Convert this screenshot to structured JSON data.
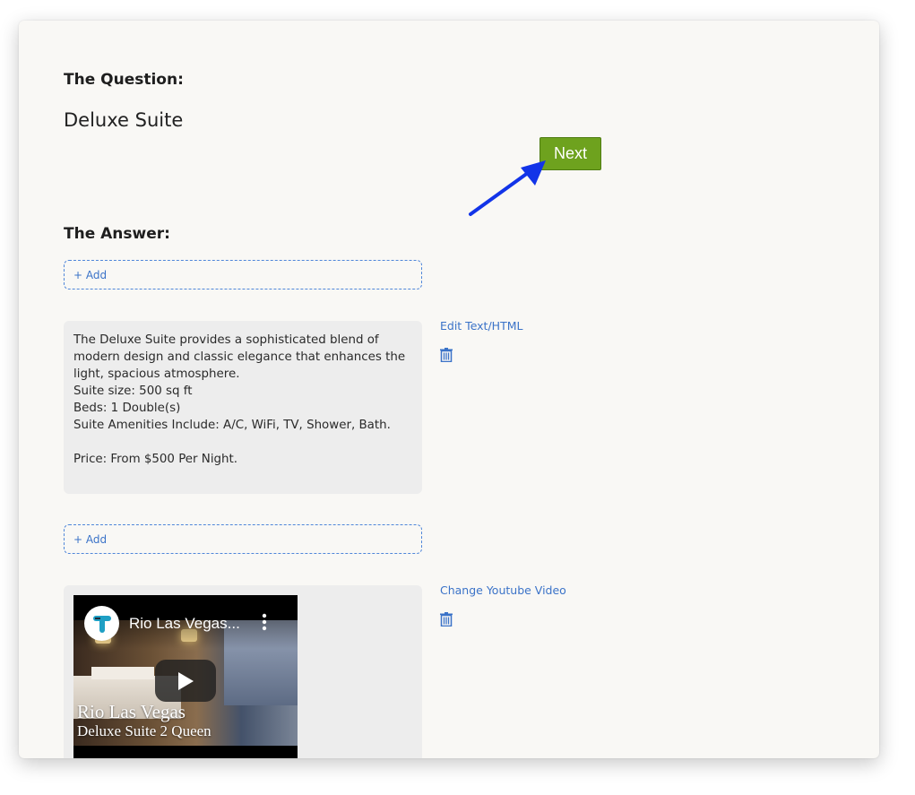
{
  "question": {
    "heading": "The Question:",
    "text": "Deluxe Suite"
  },
  "next_button": {
    "label": "Next",
    "color": "#6ea21e"
  },
  "arrow": {
    "color": "#1234e8"
  },
  "answer": {
    "heading": "The Answer:",
    "add_label": "+ Add",
    "text_block": {
      "lines": [
        "The Deluxe Suite provides a sophisticated blend of",
        "modern design and classic elegance that enhances the",
        "light, spacious atmosphere.",
        "Suite size: 500 sq ft",
        "Beds: 1 Double(s)",
        "Suite Amenities Include: A/C, WiFi, TV, Shower, Bath.",
        "",
        "Price: From $500 Per Night."
      ],
      "edit_link": "Edit Text/HTML",
      "delete_icon": "trash-icon"
    },
    "video_block": {
      "title": "Rio Las Vegas...",
      "caption_line1": "Rio Las Vegas",
      "caption_line2": "Deluxe Suite 2 Queen",
      "change_link": "Change Youtube Video",
      "delete_icon": "trash-icon",
      "play_icon": "play-icon",
      "menu_icon": "kebab-menu-icon"
    }
  },
  "colors": {
    "link": "#3b73c8",
    "card_bg": "#f9f8f5",
    "box_bg": "#ededed"
  }
}
